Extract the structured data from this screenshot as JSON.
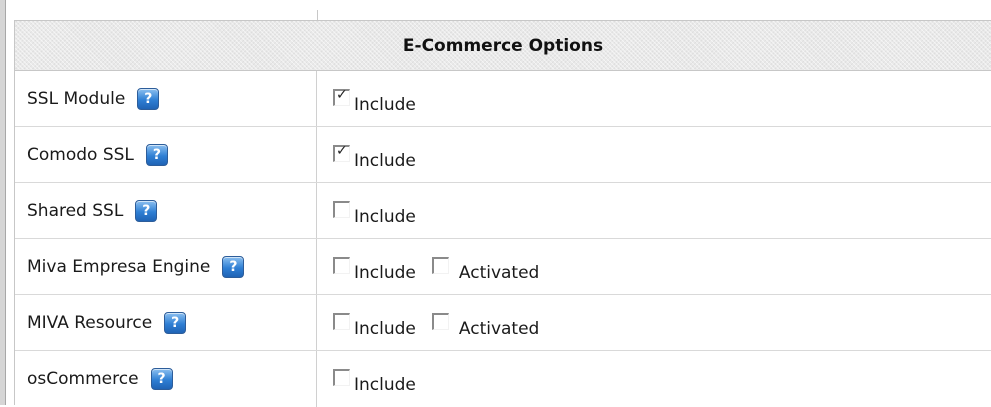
{
  "section": {
    "title": "E-Commerce Options"
  },
  "rows": [
    {
      "label": "SSL Module",
      "help": "?",
      "include": {
        "label": "Include",
        "checked": true
      }
    },
    {
      "label": "Comodo SSL",
      "help": "?",
      "include": {
        "label": "Include",
        "checked": true
      }
    },
    {
      "label": "Shared SSL",
      "help": "?",
      "include": {
        "label": "Include",
        "checked": false
      }
    },
    {
      "label": "Miva Empresa Engine",
      "help": "?",
      "include": {
        "label": "Include",
        "checked": false
      },
      "activated": {
        "label": "Activated",
        "checked": false
      }
    },
    {
      "label": "MIVA Resource",
      "help": "?",
      "include": {
        "label": "Include",
        "checked": false
      },
      "activated": {
        "label": "Activated",
        "checked": false
      }
    },
    {
      "label": "osCommerce",
      "help": "?",
      "include": {
        "label": "Include",
        "checked": false
      }
    }
  ],
  "icons": {
    "help": "help-question-icon",
    "check": "checkmark-icon"
  },
  "colors": {
    "header_bg": "#e9e9e9",
    "help_icon_blue": "#2f7fd4",
    "border": "#c7c7c7"
  }
}
